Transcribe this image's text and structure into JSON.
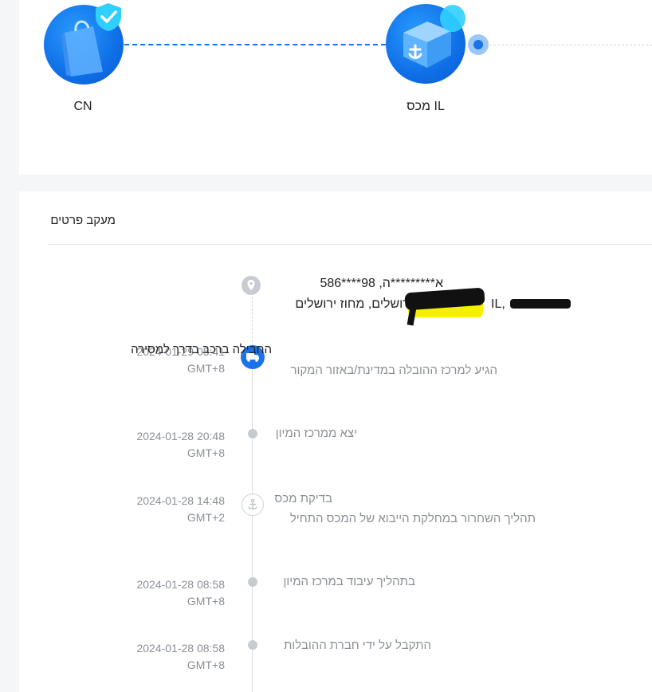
{
  "progress": {
    "stages": [
      {
        "label": "CN",
        "icon": "shopping-bag-icon",
        "badge": "shield-check-icon"
      },
      {
        "label": "מכס IL",
        "icon": "customs-package-icon"
      }
    ],
    "colors": {
      "accent": "#1a73e8",
      "circle": "#0f6fe6",
      "muted": "#8a8f96"
    }
  },
  "details": {
    "title": "מעקב פרטים",
    "address": {
      "line1": "א*********ה,  98****586",
      "line2": "ירושלים,  מחוז ירושלים"
    },
    "events": [
      {
        "time": "2024-01-29 05:41",
        "tz": "GMT+8",
        "title": "החבילה ברכב בדרך למסירה",
        "desc": "הגיע למרכז ההובלה במדינת/באזור המקור",
        "icon": "truck-icon"
      },
      {
        "time": "2024-01-28 20:48",
        "tz": "GMT+8",
        "title": "יצא ממרכז המיון",
        "desc": ""
      },
      {
        "time": "2024-01-28 14:48",
        "tz": "GMT+2",
        "title": "בדיקת מכס",
        "desc": "תהליך השחרור במחלקת הייבוא של המכס התחיל",
        "icon": "anchor-icon"
      },
      {
        "time": "2024-01-28 08:58",
        "tz": "GMT+8",
        "title": "בתהליך עיבוד במרכז המיון",
        "desc": ""
      },
      {
        "time": "2024-01-28 08:58",
        "tz": "GMT+8",
        "title": "התקבל על ידי חברת ההובלות",
        "desc": ""
      }
    ]
  }
}
